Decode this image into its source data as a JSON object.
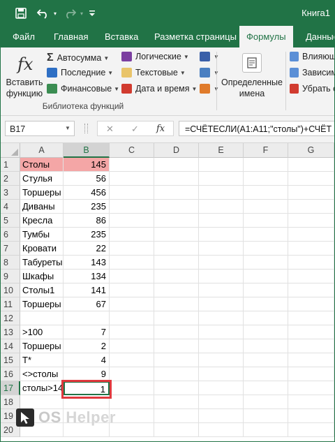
{
  "titlebar": {
    "app_title": "Книга1",
    "save_icon": "save-icon",
    "undo_icon": "undo-icon",
    "redo_icon": "redo-icon"
  },
  "tabs": [
    "Файл",
    "Главная",
    "Вставка",
    "Разметка страницы",
    "Формулы",
    "Данные"
  ],
  "active_tab": "Формулы",
  "ribbon": {
    "insert_function": [
      "Вставить",
      "функцию"
    ],
    "fx_symbol": "fx",
    "items": {
      "autosum": "Автосумма",
      "recent": "Последние",
      "financial": "Финансовые",
      "logical": "Логические",
      "text": "Текстовые",
      "datetime": "Дата и время"
    },
    "defined_names": [
      "Определенные",
      "имена"
    ],
    "group_label": "Библиотека функций",
    "audit": {
      "trace_precedents": "Влияющ",
      "trace_dependents": "Зависим",
      "remove_arrows": "Убрать с"
    }
  },
  "formula_bar": {
    "name_box": "B17",
    "cancel": "✕",
    "enter": "✓",
    "fx": "fx",
    "formula": "=СЧЁТЕСЛИ(A1:A11;\"столы\")+СЧЁТ"
  },
  "columns": [
    "A",
    "B",
    "C",
    "D",
    "E",
    "F",
    "G"
  ],
  "rows": [
    {
      "n": "1",
      "a": "Столы",
      "b": "145"
    },
    {
      "n": "2",
      "a": "Стулья",
      "b": "56"
    },
    {
      "n": "3",
      "a": "Торшеры",
      "b": "456"
    },
    {
      "n": "4",
      "a": "Диваны",
      "b": "235"
    },
    {
      "n": "5",
      "a": "Кресла",
      "b": "86"
    },
    {
      "n": "6",
      "a": "Тумбы",
      "b": "235"
    },
    {
      "n": "7",
      "a": "Кровати",
      "b": "22"
    },
    {
      "n": "8",
      "a": "Табуреты",
      "b": "143"
    },
    {
      "n": "9",
      "a": "Шкафы",
      "b": "134"
    },
    {
      "n": "10",
      "a": "Столы1",
      "b": "141"
    },
    {
      "n": "11",
      "a": "Торшеры",
      "b": "67"
    },
    {
      "n": "12",
      "a": "",
      "b": ""
    },
    {
      "n": "13",
      "a": ">100",
      "b": "7"
    },
    {
      "n": "14",
      "a": "Торшеры",
      "b": "2"
    },
    {
      "n": "15",
      "a": "Т*",
      "b": "4"
    },
    {
      "n": "16",
      "a": "<>столы",
      "b": "9"
    },
    {
      "n": "17",
      "a": "столы>14",
      "b": "1"
    },
    {
      "n": "18",
      "a": "",
      "b": ""
    },
    {
      "n": "19",
      "a": "",
      "b": ""
    },
    {
      "n": "20",
      "a": "",
      "b": ""
    }
  ],
  "selected_cell": "B17",
  "watermark": {
    "text_a": "OS",
    "text_b": "Helper"
  },
  "colors": {
    "accent": "#217346",
    "highlight": "#f4a6a6",
    "callout": "#e0393e"
  }
}
